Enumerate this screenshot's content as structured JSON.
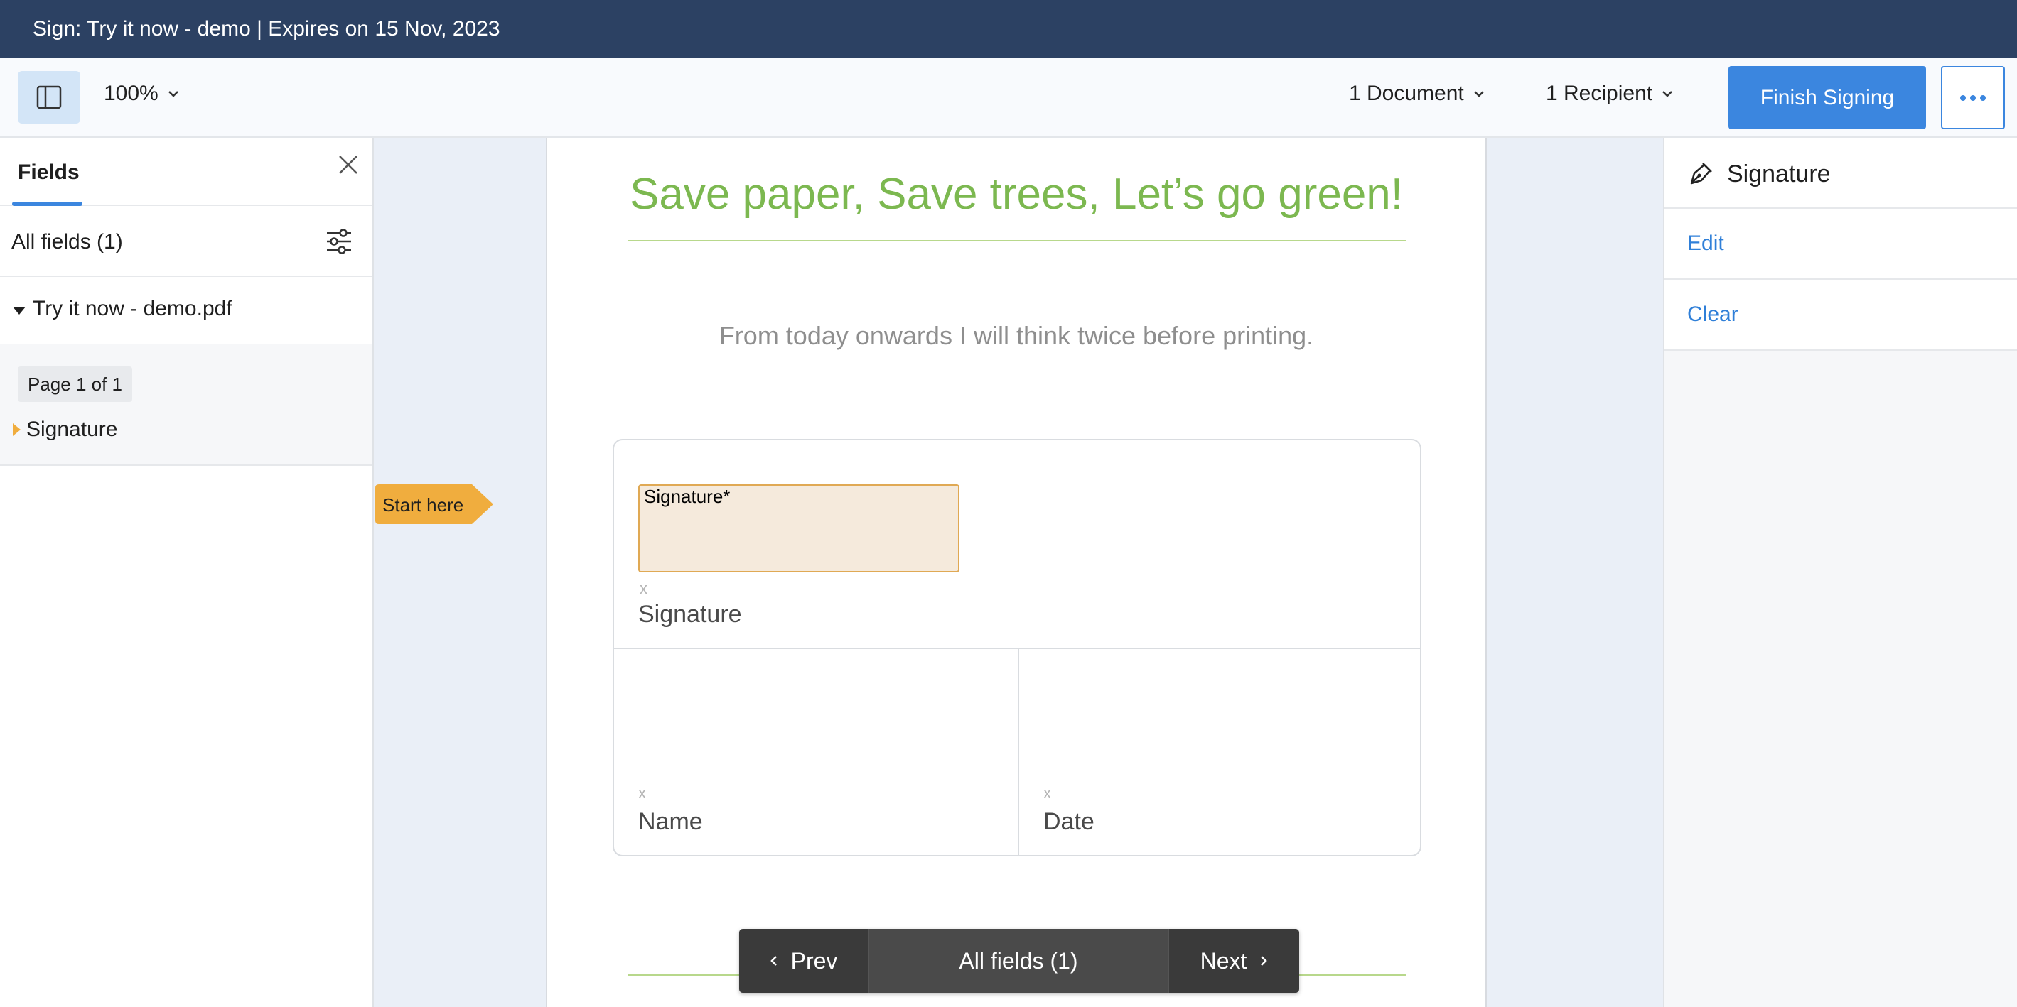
{
  "titlebar": {
    "title": "Sign: Try it now - demo | Expires on 15 Nov, 2023"
  },
  "toolbar": {
    "zoom": "100%",
    "documents": "1 Document",
    "recipients": "1 Recipient",
    "finish_label": "Finish Signing"
  },
  "left_panel": {
    "tab": "Fields",
    "all_fields": "All fields (1)",
    "document_name": "Try it now - demo.pdf",
    "page_badge": "Page 1 of 1",
    "field_item": "Signature"
  },
  "document": {
    "heading": "Save paper, Save trees, Let’s go green!",
    "subheading": "From today onwards I will think twice before printing.",
    "signature_field_label": "Signature*",
    "x_mark": "x",
    "signature_caption": "Signature",
    "name_caption": "Name",
    "date_caption": "Date"
  },
  "start_flag": "Start here",
  "bottom_nav": {
    "prev": "Prev",
    "all_fields": "All fields (1)",
    "next": "Next"
  },
  "right_panel": {
    "title": "Signature",
    "edit": "Edit",
    "clear": "Clear"
  },
  "colors": {
    "titlebar": "#2c4163",
    "accent": "#3b86df",
    "heading_green": "#7cb850",
    "signature_fill": "#f5eadc",
    "start_flag": "#f0ad3e"
  }
}
